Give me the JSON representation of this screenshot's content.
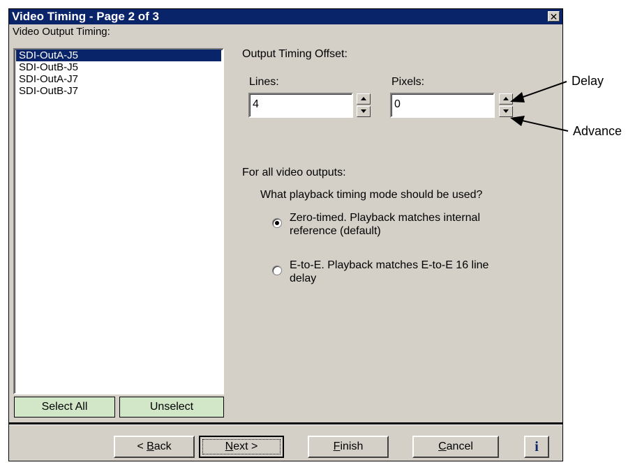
{
  "window": {
    "title": "Video Timing - Page 2 of 3",
    "close_symbol": "✕"
  },
  "list": {
    "label": "Video Output Timing:",
    "items": [
      "SDI-OutA-J5",
      "SDI-OutB-J5",
      "SDI-OutA-J7",
      "SDI-OutB-J7"
    ],
    "selected_index": 0,
    "select_all_label": "Select All",
    "unselect_label": "Unselect"
  },
  "offset": {
    "title": "Output Timing Offset:",
    "lines_label": "Lines:",
    "lines_value": "4",
    "pixels_label": "Pixels:",
    "pixels_value": "0"
  },
  "playback": {
    "heading": "For all video outputs:",
    "question": "What playback timing mode should be used?",
    "options": [
      {
        "line1": "Zero-timed. Playback matches internal",
        "line2": "reference (default)",
        "selected": true
      },
      {
        "line1": "E-to-E. Playback matches E-to-E 16 line",
        "line2": "delay",
        "selected": false
      }
    ]
  },
  "footer": {
    "back": {
      "pre": "< ",
      "acc": "B",
      "post": "ack"
    },
    "next": {
      "pre": "",
      "acc": "N",
      "post": "ext >"
    },
    "finish": {
      "pre": "",
      "acc": "F",
      "post": "inish"
    },
    "cancel": {
      "pre": "",
      "acc": "C",
      "post": "ancel"
    },
    "info": "i"
  },
  "annotations": {
    "delay": "Delay",
    "advance": "Advance"
  },
  "colors": {
    "titlebar": "#0a246a",
    "dialog_face": "#d4d0c8",
    "select_button_green": "#d2e6c8",
    "info_blue": "#0a246a"
  }
}
